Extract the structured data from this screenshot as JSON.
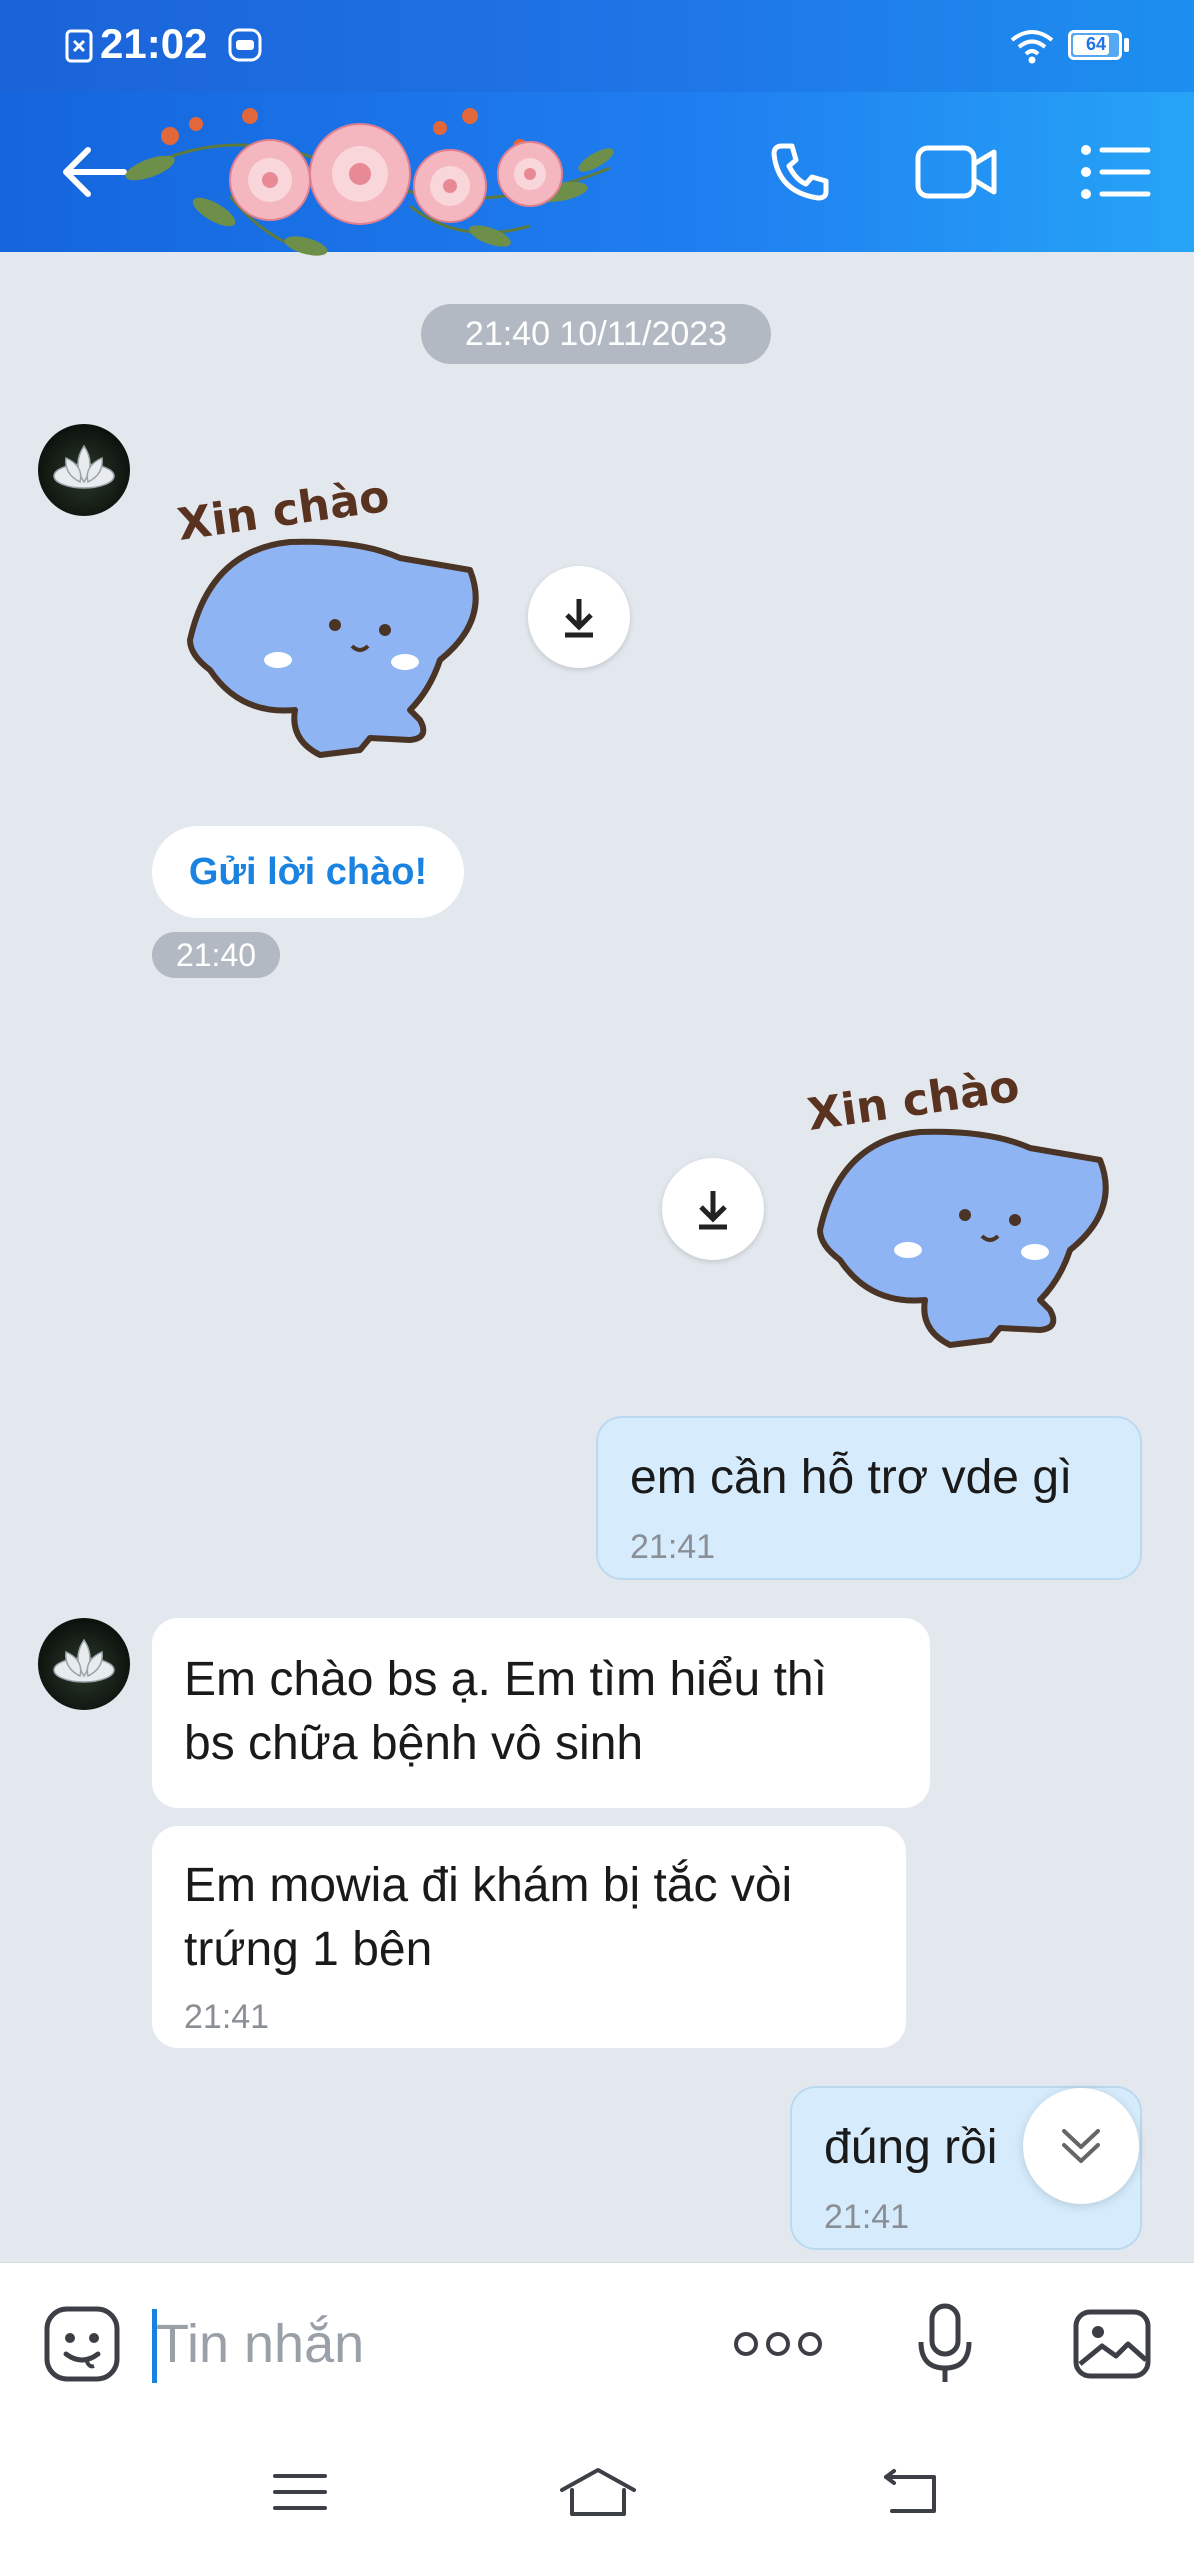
{
  "status_bar": {
    "time": "21:02",
    "battery": "64"
  },
  "header": {},
  "chat": {
    "date_separator": "21:40 10/11/2023",
    "sticker_caption": "Xin chào",
    "greet_button": "Gửi lời chào!",
    "greet_time": "21:40",
    "messages": [
      {
        "from": "me",
        "text": "em cần hỗ trơ vde gì",
        "time": "21:41"
      },
      {
        "from": "other",
        "text": "Em chào bs ạ. Em tìm hiểu thì\nbs chữa bệnh vô sinh"
      },
      {
        "from": "other",
        "text": "Em mowia đi khám bị tắc vòi\ntrứng 1 bên",
        "time": "21:41"
      },
      {
        "from": "me",
        "text": "đúng rồi",
        "time": "21:41"
      }
    ]
  },
  "composer": {
    "placeholder": "Tin nhắn"
  },
  "colors": {
    "accent": "#1a82e0",
    "header": "#1f74e6",
    "outgoing_bubble": "#d6ecfc",
    "background": "#e3e8ef"
  }
}
